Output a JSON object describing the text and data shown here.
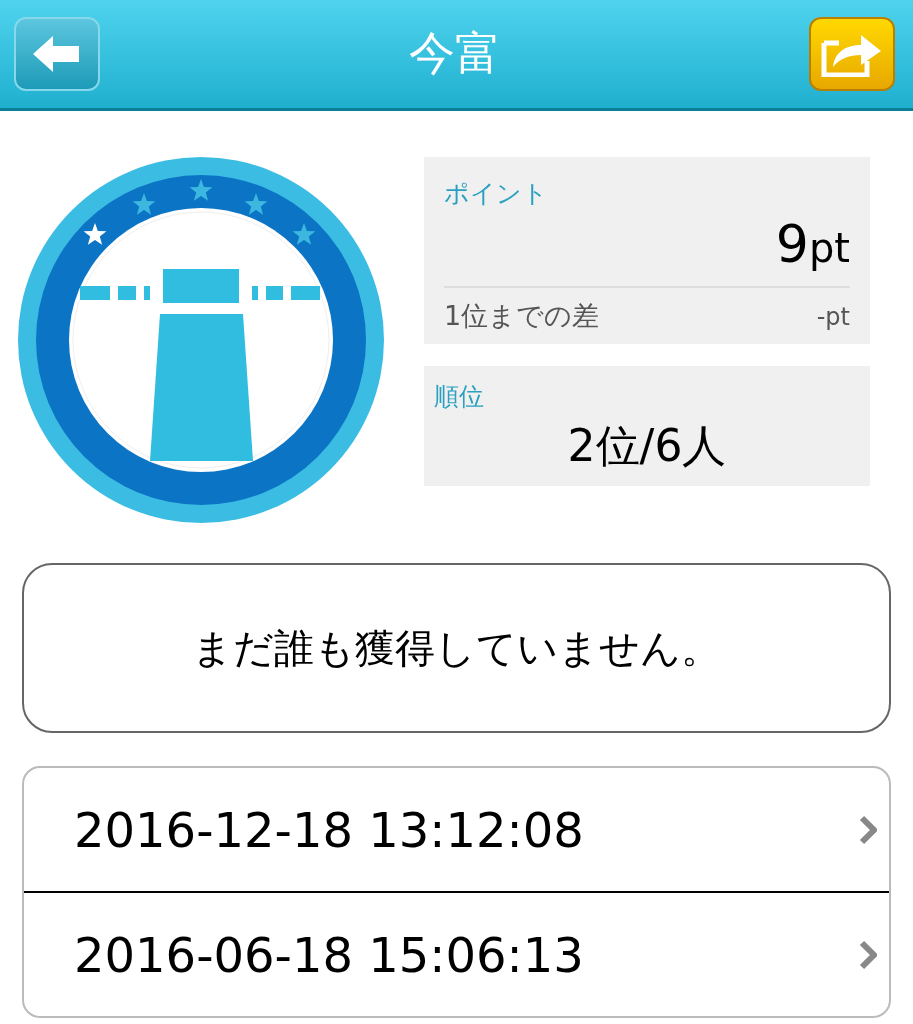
{
  "header": {
    "title": "今富"
  },
  "points": {
    "label": "ポイント",
    "value": "9",
    "unit": "pt",
    "gap_label": "1位までの差",
    "gap_value": "-pt"
  },
  "rank": {
    "label": "順位",
    "value": "2位/6人"
  },
  "message": "まだ誰も獲得していません。",
  "history": [
    {
      "datetime": "2016-12-18 13:12:08"
    },
    {
      "datetime": "2016-06-18 15:06:13"
    }
  ]
}
